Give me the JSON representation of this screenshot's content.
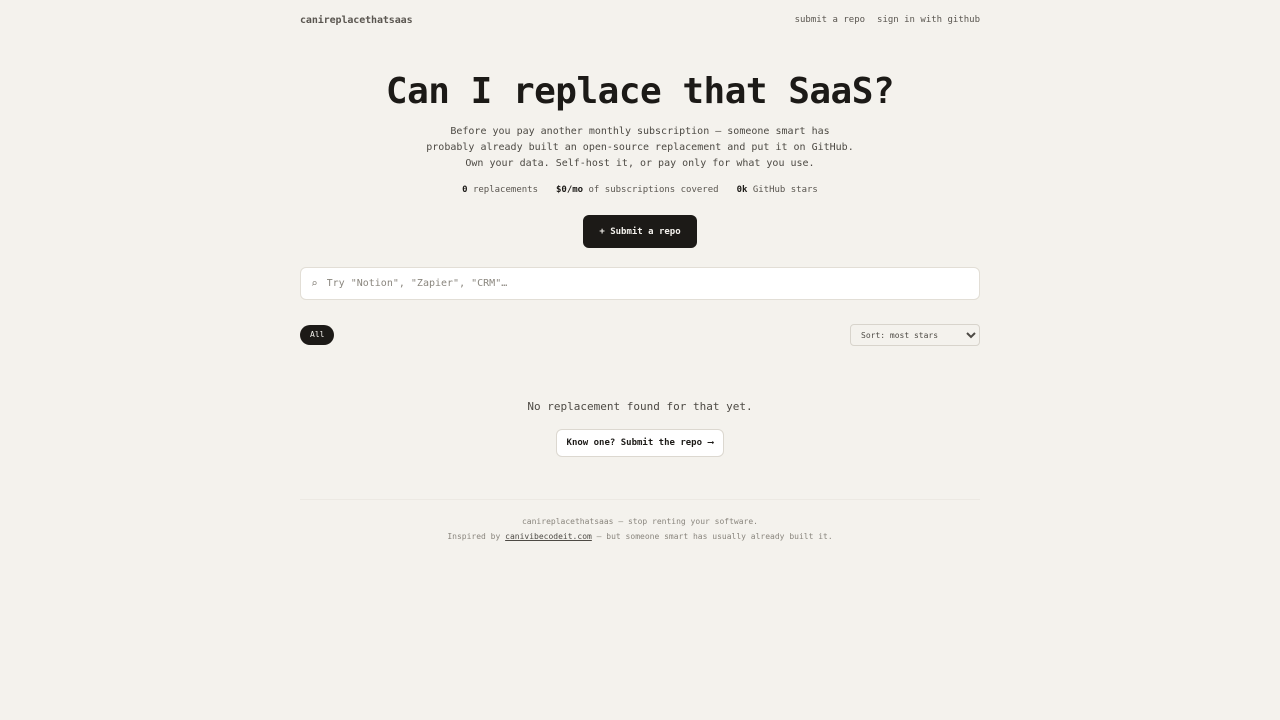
{
  "header": {
    "logo": "canireplacethatsaas",
    "nav": {
      "submit": "submit a repo",
      "signin": "sign in with github"
    }
  },
  "hero": {
    "title": "Can I replace that SaaS?",
    "subtitle_lines": [
      "Before you pay another monthly subscription — someone smart has",
      "probably already built an open-source replacement and put it on GitHub.",
      "Own your data. Self-host it, or pay only for what you use."
    ],
    "stats": {
      "replacements_value": "0",
      "replacements_label": "replacements",
      "covered_value": "$0/mo",
      "covered_label": "of subscriptions covered",
      "stars_value": "0k",
      "stars_label": "GitHub stars"
    },
    "cta_label": "+ Submit a repo"
  },
  "search": {
    "icon": "search-icon",
    "placeholder": "Try \"Notion\", \"Zapier\", \"CRM\"…"
  },
  "filters": {
    "chip_all": "All",
    "sort_selected": "Sort: most stars"
  },
  "empty": {
    "message": "No replacement found for that yet.",
    "button_label": "Know one? Submit the repo",
    "button_arrow": "⟶"
  },
  "footer": {
    "line1": "canireplacethatsaas — stop renting your software.",
    "line2_prefix": "Inspired by",
    "line2_link": "canivibecodeit.com",
    "line2_suffix": "— but someone smart has usually already built it."
  }
}
